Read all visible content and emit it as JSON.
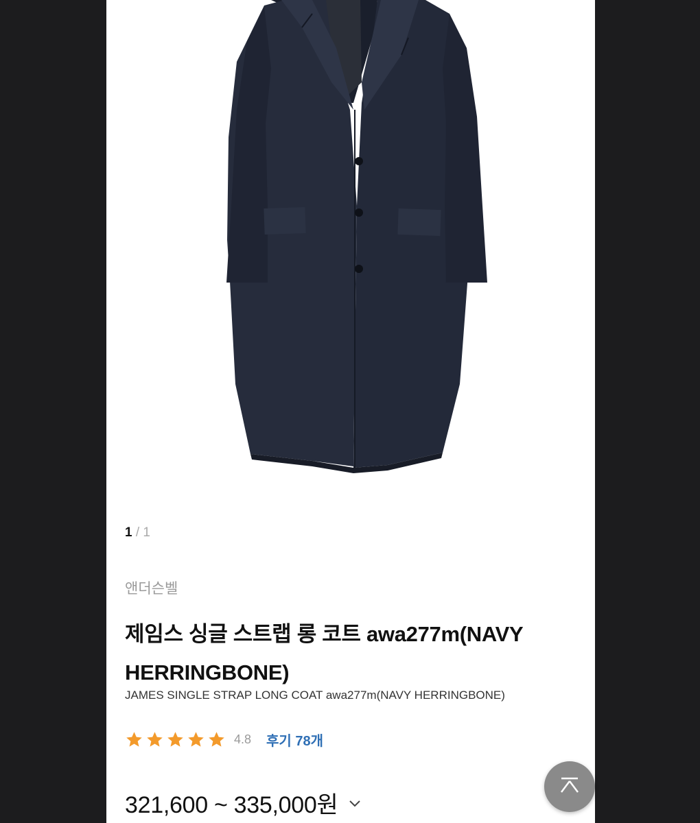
{
  "gallery": {
    "current": "1",
    "separator": "/",
    "total": "1",
    "image_subject": "navy herringbone long coat"
  },
  "product": {
    "brand": "앤더슨벨",
    "title": "제임스 싱글 스트랩 롱 코트 awa277m(NAVY HERRINGBONE)",
    "subtitle": "JAMES SINGLE STRAP LONG COAT awa277m(NAVY HERRINGBONE)",
    "rating": {
      "stars": 5,
      "value": "4.8",
      "review_label": "후기 78개"
    },
    "price_range": "321,600 ~ 335,000원"
  },
  "icons": {
    "star": "star-icon",
    "chevron": "chevron-down-icon",
    "top": "scroll-top-icon"
  },
  "colors": {
    "star": "#f39a2b",
    "review_link": "#2f6fb5",
    "coat": "#252b3b",
    "top_button": "#8a8a8a"
  }
}
